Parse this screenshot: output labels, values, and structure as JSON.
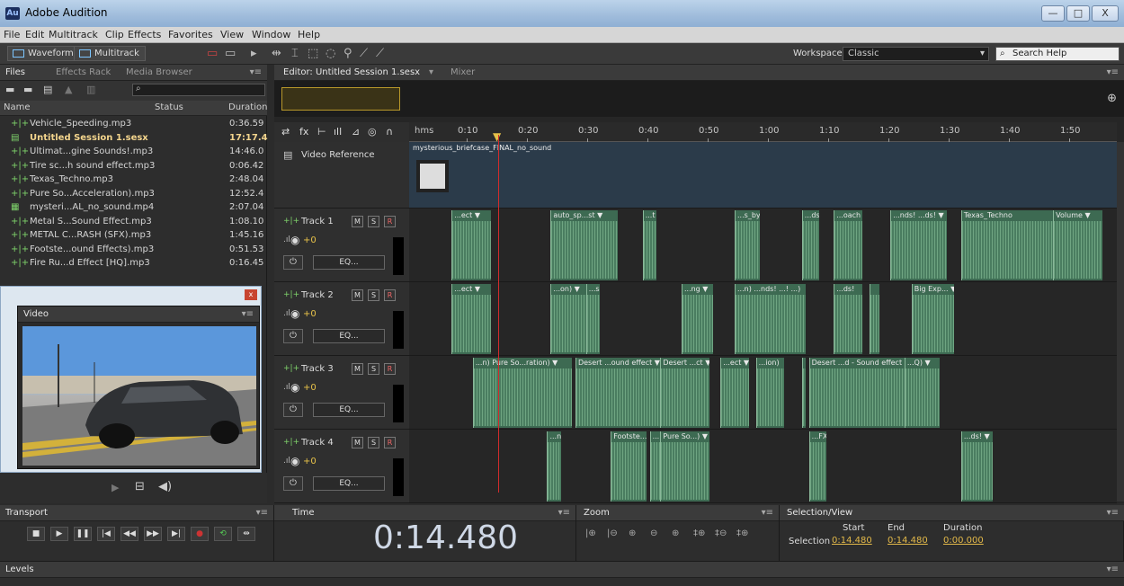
{
  "window": {
    "title": "Adobe Audition",
    "logo": "Au",
    "controls": [
      "—",
      "□",
      "X"
    ]
  },
  "menu": [
    "File",
    "Edit",
    "Multitrack",
    "Clip",
    "Effects",
    "Favorites",
    "View",
    "Window",
    "Help"
  ],
  "toolbar": {
    "waveform_label": "Waveform",
    "multitrack_label": "Multitrack",
    "workspace_label": "Workspace:",
    "workspace_value": "Classic",
    "search_placeholder": "Search Help"
  },
  "files_panel": {
    "tabs": [
      "Files",
      "Effects Rack",
      "Media Browser"
    ],
    "columns": {
      "name": "Name",
      "status": "Status",
      "duration": "Duration"
    },
    "files": [
      {
        "name": "Vehicle_Speeding.mp3",
        "duration": "0:36.59"
      },
      {
        "name": "Untitled Session 1.sesx",
        "duration": "17:17.4"
      },
      {
        "name": "Ultimat...gine Sounds!.mp3",
        "duration": "14:46.0"
      },
      {
        "name": "Tire sc...h sound effect.mp3",
        "duration": "0:06.42"
      },
      {
        "name": "Texas_Techno.mp3",
        "duration": "2:48.04"
      },
      {
        "name": "Pure So...Acceleration).mp3",
        "duration": "12:52.4"
      },
      {
        "name": "mysteri...AL_no_sound.mp4",
        "duration": "2:07.04"
      },
      {
        "name": "Metal S...Sound Effect.mp3",
        "duration": "1:08.10"
      },
      {
        "name": "METAL C...RASH (SFX).mp3",
        "duration": "1:45.16"
      },
      {
        "name": "Footste...ound Effects).mp3",
        "duration": "0:51.53"
      },
      {
        "name": "Fire Ru...d Effect [HQ].mp3",
        "duration": "0:16.45"
      }
    ]
  },
  "video_panel": {
    "tab": "Video"
  },
  "editor": {
    "tab": "Editor: Untitled Session 1.sesx",
    "mixer_tab": "Mixer",
    "ruler": [
      "hms",
      "0:10",
      "0:20",
      "0:30",
      "0:40",
      "0:50",
      "1:00",
      "1:10",
      "1:20",
      "1:30",
      "1:40",
      "1:50"
    ],
    "video_reference_label": "Video Reference",
    "video_clip_name": "mysterious_briefcase_FINAL_no_sound",
    "tracks": [
      {
        "name": "Track 1",
        "volume": "+0",
        "eq": "EQ...",
        "clips": [
          {
            "label": "...ect ▼",
            "start": 0.06,
            "width": 0.055
          },
          {
            "label": "auto_sp...st ▼",
            "start": 0.2,
            "width": 0.095
          },
          {
            "label": "...t",
            "start": 0.33,
            "width": 0.02
          },
          {
            "label": "...s_by",
            "start": 0.46,
            "width": 0.035
          },
          {
            "label": "...ds!",
            "start": 0.555,
            "width": 0.025
          },
          {
            "label": "...oach",
            "start": 0.6,
            "width": 0.04
          },
          {
            "label": "...nds! ...ds! ▼",
            "start": 0.68,
            "width": 0.08
          },
          {
            "label": "Texas_Techno",
            "start": 0.78,
            "width": 0.2
          },
          {
            "label": "Volume ▼",
            "start": 0.91,
            "width": 0.07
          }
        ]
      },
      {
        "name": "Track 2",
        "volume": "+0",
        "eq": "EQ...",
        "clips": [
          {
            "label": "...ect ▼",
            "start": 0.06,
            "width": 0.055
          },
          {
            "label": "...on) ▼",
            "start": 0.2,
            "width": 0.05
          },
          {
            "label": "...se",
            "start": 0.25,
            "width": 0.02
          },
          {
            "label": "...ng ▼",
            "start": 0.385,
            "width": 0.045
          },
          {
            "label": "...n) ...nds! ...! ...)",
            "start": 0.46,
            "width": 0.1
          },
          {
            "label": "...ds!",
            "start": 0.6,
            "width": 0.04
          },
          {
            "label": "",
            "start": 0.65,
            "width": 0.015
          },
          {
            "label": "Big Exp... ▼",
            "start": 0.71,
            "width": 0.06
          }
        ]
      },
      {
        "name": "Track 3",
        "volume": "+0",
        "eq": "EQ...",
        "clips": [
          {
            "label": "...n)  Pure So...ration) ▼",
            "start": 0.09,
            "width": 0.14
          },
          {
            "label": "Desert ...ound effect ▼",
            "start": 0.235,
            "width": 0.12
          },
          {
            "label": "Desert ...ct ▼",
            "start": 0.355,
            "width": 0.07
          },
          {
            "label": "...ect ▼",
            "start": 0.44,
            "width": 0.04
          },
          {
            "label": "...ion)",
            "start": 0.49,
            "width": 0.04
          },
          {
            "label": "",
            "start": 0.555,
            "width": 0.005
          },
          {
            "label": "Desert ...d - Sound effect ... ▼",
            "start": 0.565,
            "width": 0.14
          },
          {
            "label": "...Q) ▼",
            "start": 0.7,
            "width": 0.05
          }
        ]
      },
      {
        "name": "Track 4",
        "volume": "+0",
        "eq": "EQ...",
        "clips": [
          {
            "label": "...n)",
            "start": 0.195,
            "width": 0.02
          },
          {
            "label": "Footste...",
            "start": 0.285,
            "width": 0.05
          },
          {
            "label": "...)",
            "start": 0.34,
            "width": 0.015
          },
          {
            "label": "Pure So...) ▼",
            "start": 0.355,
            "width": 0.07
          },
          {
            "label": "...FX)",
            "start": 0.565,
            "width": 0.025
          },
          {
            "label": "...ds! ▼",
            "start": 0.78,
            "width": 0.045
          }
        ]
      }
    ]
  },
  "transport": {
    "tab": "Transport"
  },
  "time_panel": {
    "tab": "Time",
    "time": "0:14.480"
  },
  "zoom_panel": {
    "tab": "Zoom"
  },
  "selection_panel": {
    "tab": "Selection/View",
    "row_label": "Selection",
    "start_header": "Start",
    "end_header": "End",
    "duration_header": "Duration",
    "start": "0:14.480",
    "end": "0:14.480",
    "duration": "0:00.000"
  },
  "levels_panel": {
    "tab": "Levels"
  }
}
